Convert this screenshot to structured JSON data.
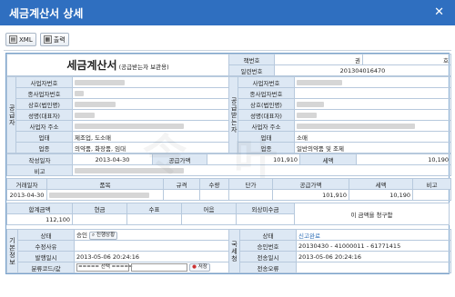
{
  "window": {
    "title": "세금계산서 상세",
    "close_symbol": "✕"
  },
  "toolbar": {
    "xml_label": "XML",
    "print_label": "출력"
  },
  "doc": {
    "title": "세금계산서",
    "title_sub": "(공급받는자 보관용)",
    "book_no_label": "책번호",
    "book_unit1": "권",
    "book_unit2": "호",
    "serial_label": "일련번호",
    "serial_value": "201304016470",
    "supplier_section": "공급자",
    "buyer_section": "공급받는자",
    "reg_no_label": "사업자번호",
    "sub_reg_label": "종사업자번호",
    "company_label": "상호(법인명)",
    "ceo_label": "성명(대표자)",
    "address_label": "사업자 주소",
    "biz_type_label": "업태",
    "biz_item_label": "업종",
    "supplier_biz_type": "제조업, 도소매",
    "supplier_biz_item": "의약품, 화장품, 임대",
    "buyer_biz_type": "소매",
    "buyer_biz_item": "일반의약품 및 조제",
    "date_label": "작성일자",
    "date_value": "2013-04-30",
    "supply_label": "공급가액",
    "supply_value": "101,910",
    "tax_label": "세액",
    "tax_value": "10,190",
    "note_label": "비고"
  },
  "items": {
    "headers": [
      "거래일자",
      "품목",
      "규격",
      "수량",
      "단가",
      "공급가액",
      "세액",
      "비고"
    ],
    "row": {
      "date": "2013-04-30",
      "supply": "101,910",
      "tax": "10,190"
    }
  },
  "totals": {
    "headers": [
      "합계금액",
      "현금",
      "수표",
      "어음",
      "외상미수금"
    ],
    "total_value": "112,100",
    "claim_text": "이 금액을 청구함"
  },
  "basic_info": {
    "section": "기본정보",
    "status_label": "상태",
    "status_value": "승인",
    "progress_button": "진행상황",
    "reason_label": "수정사유",
    "issue_date_label": "발행일시",
    "issue_date_value": "2013-05-06 20:24:16",
    "category_label": "분류코드/값",
    "select_placeholder": "===== 선택 =====",
    "save_button": "저장"
  },
  "nts_info": {
    "section": "국세청",
    "status_label": "상태",
    "status_value": "신고완료",
    "approval_label": "승인번호",
    "approval_value": "20130430 - 41000011 - 61771415",
    "sent_label": "전송일시",
    "sent_value": "2013-05-06 20:24:16",
    "error_label": "전송오류"
  },
  "colors": {
    "title_bar": "#2f6fc0",
    "label_bg": "#dde8f4",
    "border": "#b7c9dd",
    "link": "#2b6cb5"
  }
}
